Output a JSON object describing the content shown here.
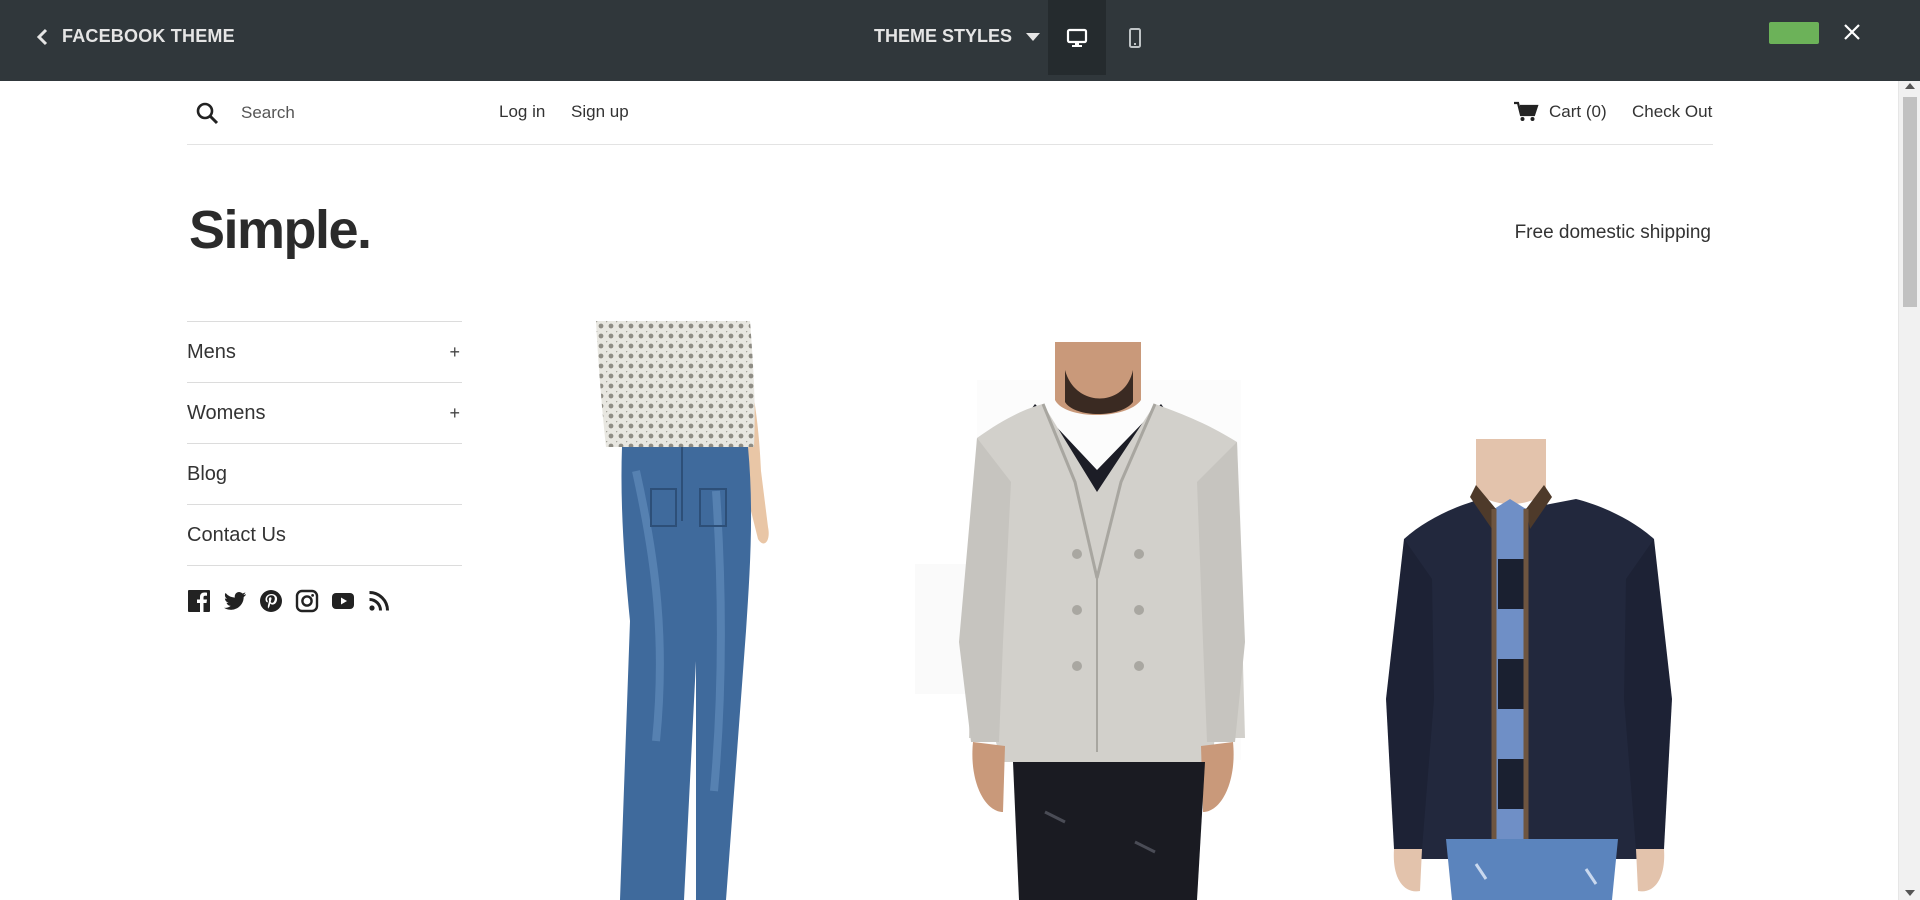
{
  "editor": {
    "back_label": "FACEBOOK THEME",
    "theme_styles_label": "THEME STYLES",
    "colors": {
      "bar": "#30373b",
      "publish": "#6cb259"
    }
  },
  "store": {
    "search": {
      "placeholder": "Search"
    },
    "login_label": "Log in",
    "signup_label": "Sign up",
    "cart_label": "Cart (0)",
    "checkout_label": "Check Out",
    "logo": "Simple.",
    "shipping_note": "Free domestic shipping",
    "menu": [
      {
        "label": "Mens",
        "expand": "+"
      },
      {
        "label": "Womens",
        "expand": "+"
      },
      {
        "label": "Blog",
        "expand": ""
      },
      {
        "label": "Contact Us",
        "expand": ""
      }
    ],
    "social_icons": [
      "facebook-icon",
      "twitter-icon",
      "pinterest-icon",
      "instagram-icon",
      "youtube-icon",
      "rss-icon"
    ]
  }
}
